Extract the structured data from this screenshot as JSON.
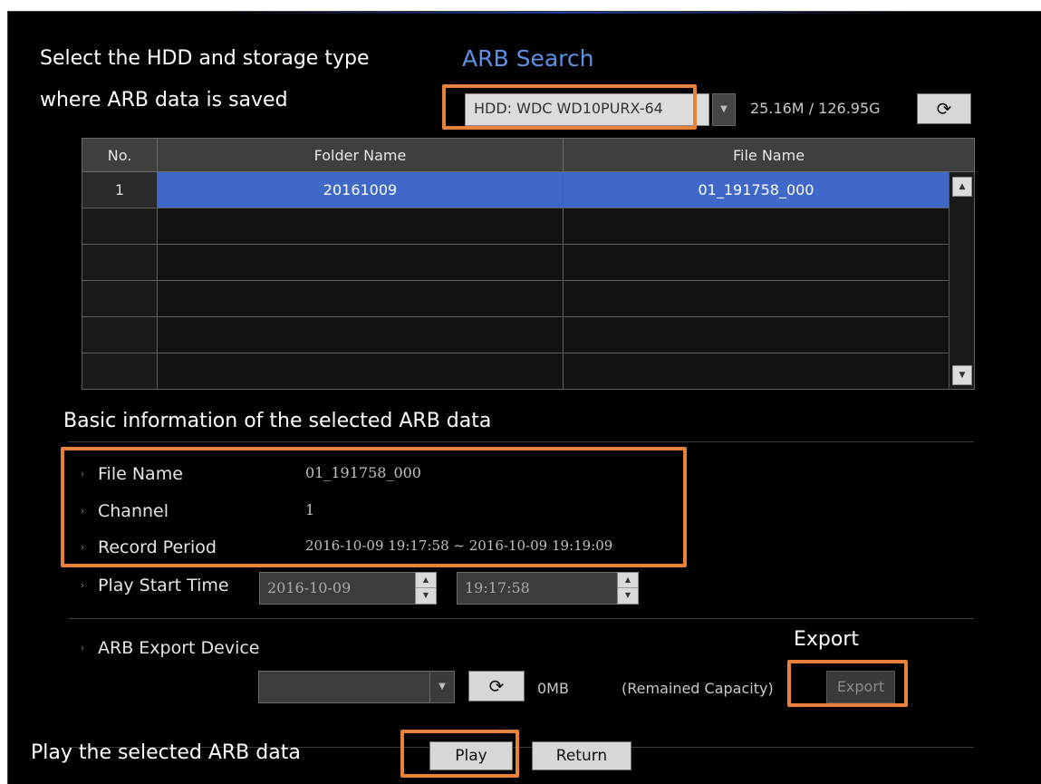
{
  "annotations": {
    "select_hdd_line1": "Select the HDD and storage type",
    "select_hdd_line2": "where ARB data is saved",
    "basic_info": "Basic information of the selected ARB data",
    "export": "Export",
    "play": "Play the selected ARB data"
  },
  "dialog": {
    "title": "ARB Search"
  },
  "hdd": {
    "selected": "HDD: WDC WD10PURX-64",
    "capacity": "25.16M / 126.95G",
    "refresh_icon": "refresh-icon"
  },
  "table": {
    "headers": [
      "No.",
      "Folder Name",
      "File Name"
    ],
    "rows": [
      {
        "no": "1",
        "folder": "20161009",
        "file": "01_191758_000"
      }
    ]
  },
  "info": {
    "file_name_label": "File Name",
    "file_name_value": "01_191758_000",
    "channel_label": "Channel",
    "channel_value": "1",
    "record_period_label": "Record Period",
    "record_period_value": "2016-10-09 19:17:58 ~ 2016-10-09 19:19:09",
    "play_start_label": "Play Start Time",
    "play_start_date": "2016-10-09",
    "play_start_time": "19:17:58"
  },
  "export": {
    "device_label": "ARB Export Device",
    "device_value": "",
    "capacity": "0MB",
    "remained_label": "(Remained Capacity)",
    "export_button": "Export"
  },
  "footer": {
    "play_button": "Play",
    "return_button": "Return"
  },
  "colors": {
    "accent_orange": "#e8813a",
    "title_blue": "#5d91e6",
    "selection_blue": "#3f68c8"
  }
}
